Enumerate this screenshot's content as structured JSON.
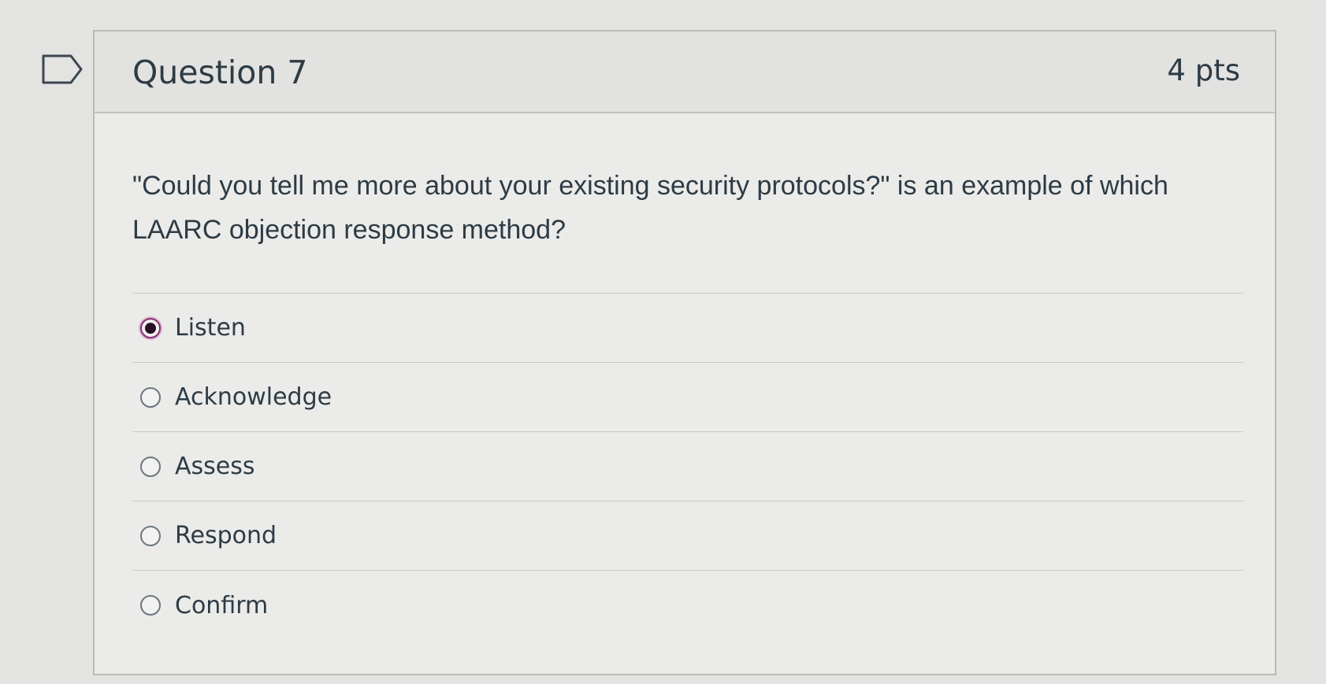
{
  "question": {
    "title": "Question 7",
    "points": "4 pts",
    "text": "\"Could you tell me more about your existing security protocols?\" is an example of which LAARC objection response method?"
  },
  "answers": [
    {
      "label": "Listen",
      "selected": true
    },
    {
      "label": "Acknowledge",
      "selected": false
    },
    {
      "label": "Assess",
      "selected": false
    },
    {
      "label": "Respond",
      "selected": false
    },
    {
      "label": "Confirm",
      "selected": false
    }
  ],
  "colors": {
    "selected_radio_ring": "#8a2c73",
    "text": "#2d3b45"
  },
  "icons": {
    "flag": "flag-question-icon"
  }
}
